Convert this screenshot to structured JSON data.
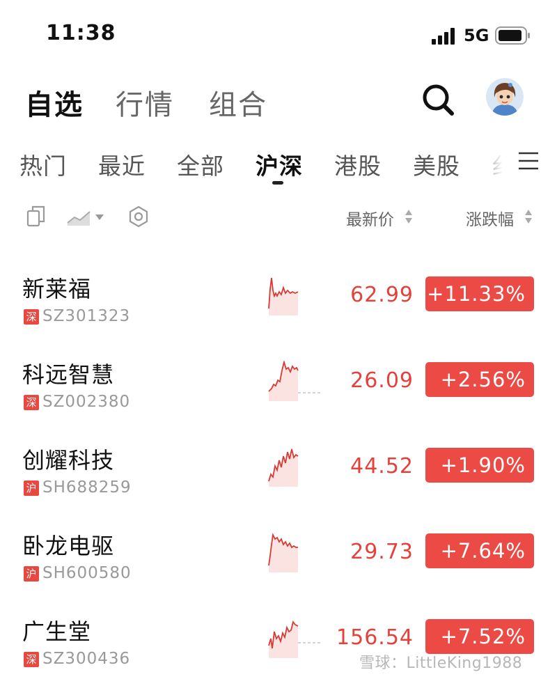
{
  "status_bar": {
    "time": "11:38",
    "network": "5G"
  },
  "top_tabs": [
    {
      "label": "自选",
      "active": true
    },
    {
      "label": "行情",
      "active": false
    },
    {
      "label": "组合",
      "active": false
    }
  ],
  "market_tabs": [
    {
      "label": "热门"
    },
    {
      "label": "最近"
    },
    {
      "label": "全部"
    },
    {
      "label": "沪深",
      "active": true
    },
    {
      "label": "港股"
    },
    {
      "label": "美股"
    },
    {
      "label": "纟"
    }
  ],
  "columns": {
    "price": "最新价",
    "change": "涨跌幅"
  },
  "stocks": [
    {
      "name": "新莱福",
      "market": "深",
      "code": "SZ301323",
      "price": "62.99",
      "change": "+11.33%"
    },
    {
      "name": "科远智慧",
      "market": "深",
      "code": "SZ002380",
      "price": "26.09",
      "change": "+2.56%"
    },
    {
      "name": "创耀科技",
      "market": "沪",
      "code": "SH688259",
      "price": "44.52",
      "change": "+1.90%"
    },
    {
      "name": "卧龙电驱",
      "market": "沪",
      "code": "SH600580",
      "price": "29.73",
      "change": "+7.64%"
    },
    {
      "name": "广生堂",
      "market": "深",
      "code": "SZ300436",
      "price": "156.54",
      "change": "+7.52%"
    }
  ],
  "watermark": "雪球：LittleKing1988",
  "colors": {
    "up": "#e5413a",
    "badge": "#ec4a45",
    "text": "#111111",
    "muted": "#999999"
  },
  "icons": [
    "signal-icon",
    "battery-icon",
    "search-icon",
    "avatar",
    "menu-icon",
    "copy-icon",
    "chart-toggle-icon",
    "settings-icon",
    "sort-icon"
  ]
}
